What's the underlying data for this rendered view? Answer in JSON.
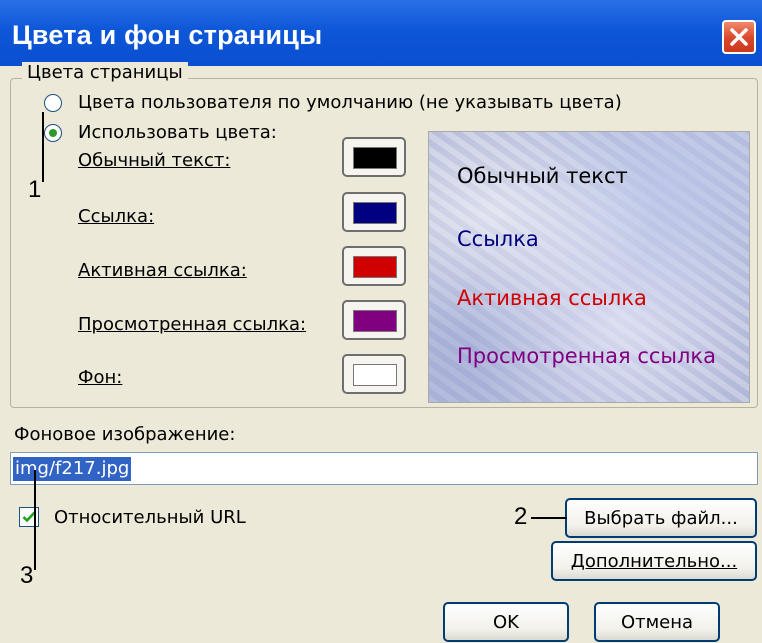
{
  "window": {
    "title": "Цвета и фон страницы"
  },
  "colors_group": {
    "legend": "Цвета страницы",
    "radio_default": "Цвета пользователя по умолчанию (не указывать цвета)",
    "radio_use": "Использовать цвета:",
    "rows": [
      {
        "label": "Обычный текст:",
        "color": "#000000"
      },
      {
        "label": "Ссылка:",
        "color": "#000080"
      },
      {
        "label": "Активная ссылка:",
        "color": "#d00000"
      },
      {
        "label": "Просмотренная ссылка:",
        "color": "#800080"
      },
      {
        "label": "Фон:",
        "color": "#ffffff"
      }
    ],
    "preview": {
      "normal_text": "Обычный текст",
      "link": "Ссылка",
      "active_link": "Активная ссылка",
      "visited_link": "Просмотренная ссылка"
    }
  },
  "background_image": {
    "label": "Фоновое изображение:",
    "value": "img/f217.jpg",
    "relative_url_label": "Относительный URL",
    "relative_url_checked": true
  },
  "buttons": {
    "browse": "Выбрать файл...",
    "advanced": "Дополнительно...",
    "ok": "OK",
    "cancel": "Отмена"
  },
  "annotations": {
    "one": "1",
    "two": "2",
    "three": "3"
  }
}
